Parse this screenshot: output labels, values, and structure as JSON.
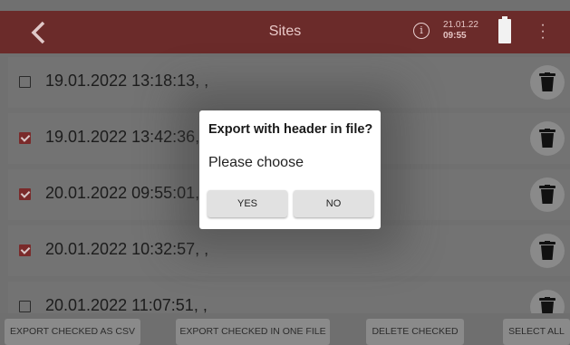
{
  "header": {
    "title": "Sites",
    "date": "21.01.22",
    "time": "09:55",
    "info_glyph": "i",
    "back_icon": "chevron-left-icon",
    "more_icon": "more-vert-icon",
    "battery_icon": "battery-full-icon",
    "bg_color": "#6b2b2a"
  },
  "sites": [
    {
      "label": "19.01.2022 13:18:13, ,",
      "checked": false
    },
    {
      "label": "19.01.2022 13:42:36, ,",
      "checked": true
    },
    {
      "label": "20.01.2022 09:55:01, ,",
      "checked": true
    },
    {
      "label": "20.01.2022 10:32:57, ,",
      "checked": true
    },
    {
      "label": "20.01.2022 11:07:51, ,",
      "checked": false
    }
  ],
  "dialog": {
    "title": "Export with header in file?",
    "message": "Please choose",
    "yes_label": "YES",
    "no_label": "NO"
  },
  "actions": {
    "export_csv": "EXPORT CHECKED AS CSV",
    "export_one_file": "EXPORT CHECKED IN ONE FILE",
    "delete_checked": "DELETE CHECKED",
    "select_all": "SELECT ALL"
  },
  "colors": {
    "accent": "#7a2a2a"
  }
}
